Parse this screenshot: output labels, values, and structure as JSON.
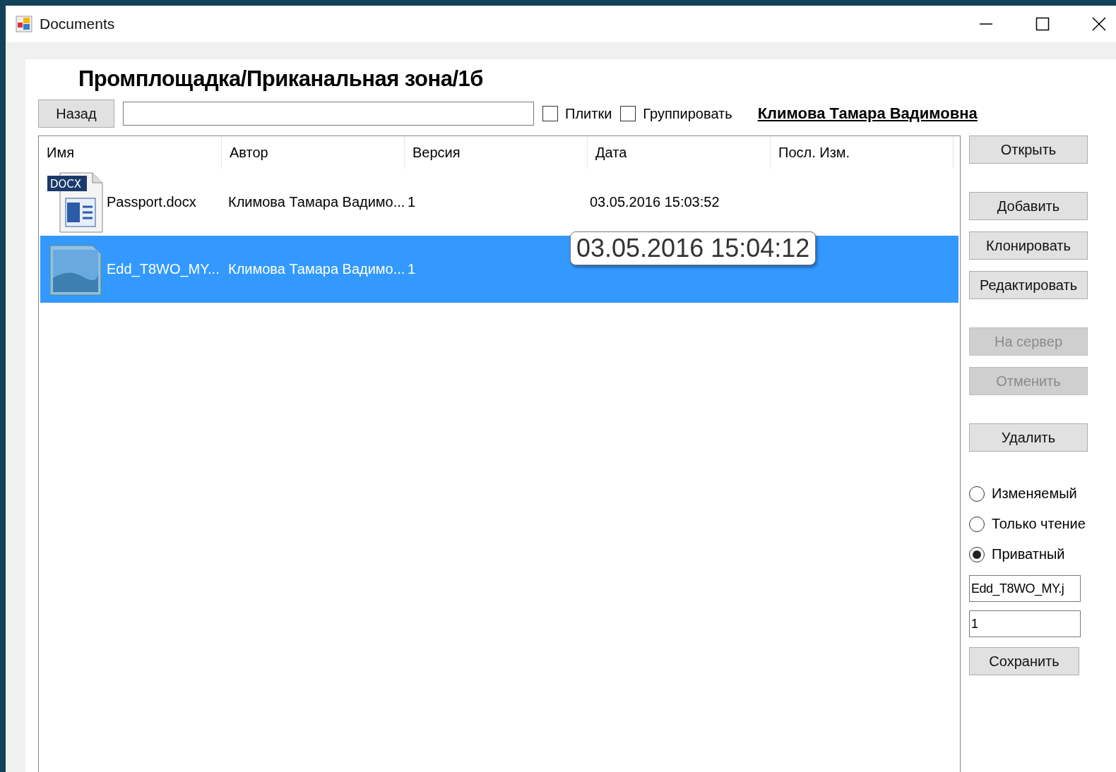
{
  "window": {
    "title": "Documents"
  },
  "path_title": "Промплощадка/Приканальная зона/1б",
  "toolbar": {
    "back_button": "Назад",
    "checkboxes": [
      {
        "label": "Плитки",
        "checked": false
      },
      {
        "label": "Группировать",
        "checked": false
      }
    ],
    "user_link": "Климова Тамара Вадимовна"
  },
  "table": {
    "columns": [
      "Имя",
      "Автор",
      "Версия",
      "Дата",
      "Посл. Изм."
    ],
    "rows": [
      {
        "kind": "docx",
        "badge": "DOCX",
        "name": "Passport.docx",
        "author": "Климова Тамара Вадимо...",
        "version": "1",
        "date": "03.05.2016 15:03:52",
        "selected": false
      },
      {
        "kind": "image",
        "name": "Edd_T8WO_MY...",
        "author": "Климова Тамара Вадимо...",
        "version": "1",
        "selected": true
      }
    ]
  },
  "tooltip": "03.05.2016 15:04:12",
  "button_groups": [
    [
      {
        "label": "Открыть",
        "disabled": false
      }
    ],
    [
      {
        "label": "Добавить",
        "disabled": false
      },
      {
        "label": "Клонировать",
        "disabled": false
      },
      {
        "label": "Редактировать",
        "disabled": false
      }
    ],
    [
      {
        "label": "На сервер",
        "disabled": true
      },
      {
        "label": "Отменить",
        "disabled": true
      }
    ],
    [
      {
        "label": "Удалить",
        "disabled": false
      }
    ]
  ],
  "access_options": [
    {
      "label": "Изменяемый",
      "selected": false
    },
    {
      "label": "Только чтение",
      "selected": false
    },
    {
      "label": "Приватный",
      "selected": true
    }
  ],
  "name_field": {
    "value": "Edd_T8WO_MY.j"
  },
  "version_field": {
    "value": "1"
  },
  "save_button": "Сохранить"
}
